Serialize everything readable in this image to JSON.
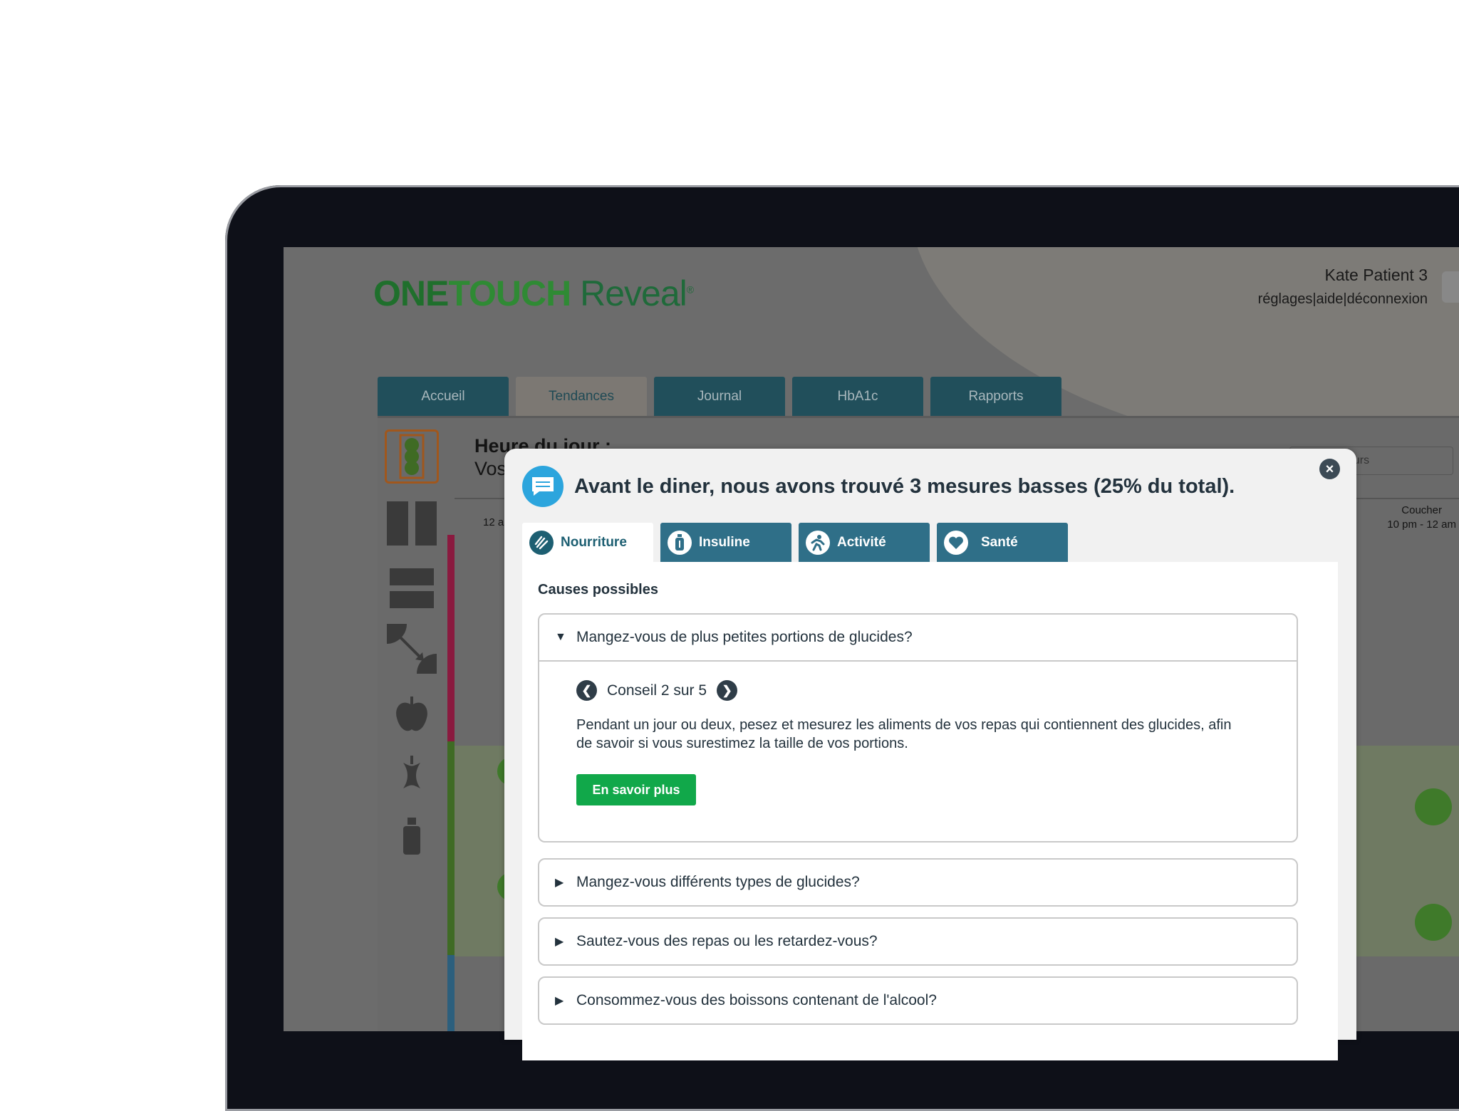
{
  "app": {
    "logo_one": "ONE",
    "logo_touch": "TOUCH",
    "logo_reveal": "Reveal",
    "logo_reg": "®"
  },
  "user": {
    "name": "Kate Patient 3",
    "links": [
      "réglages",
      "aide",
      "déconnexion"
    ],
    "separator": " | "
  },
  "nav": {
    "tabs": [
      "Accueil",
      "Tendances",
      "Journal",
      "HbA1c",
      "Rapports"
    ],
    "active_index": 1
  },
  "background_page": {
    "heading": "Heure du jour :",
    "subheading": "Vos",
    "axis_left_label": "12 a",
    "axis_right_label_line1": "Coucher",
    "axis_right_label_line2": "10 pm - 12 am",
    "select_value": "ours",
    "sidebar_icons": [
      "traffic-light-icon",
      "split-columns-icon",
      "split-rows-icon",
      "corner-arrow-icon",
      "apple-icon",
      "apple-core-icon",
      "insulin-pen-icon"
    ]
  },
  "modal": {
    "title": "Avant le diner, nous avons trouvé 3 mesures basses (25% du total).",
    "tabs": [
      {
        "label": "Nourriture",
        "icon": "food-icon"
      },
      {
        "label": "Insuline",
        "icon": "insulin-icon"
      },
      {
        "label": "Activité",
        "icon": "activity-icon"
      },
      {
        "label": "Santé",
        "icon": "health-heart-icon"
      }
    ],
    "active_tab": 0,
    "section_heading": "Causes possibles",
    "causes": [
      {
        "question": "Mangez-vous de plus petites portions de glucides?",
        "expanded": true,
        "tip_counter": "Conseil 2 sur 5",
        "tip_text": "Pendant un jour ou deux, pesez et mesurez les aliments de vos repas qui contiennent des glucides, afin de savoir si vous surestimez la taille de vos portions.",
        "button_label": "En savoir plus"
      },
      {
        "question": "Mangez-vous différents types de glucides?",
        "expanded": false
      },
      {
        "question": "Sautez-vous des repas ou les retardez-vous?",
        "expanded": false
      },
      {
        "question": "Consommez-vous des boissons contenant de l'alcool?",
        "expanded": false
      }
    ]
  },
  "colors": {
    "accent_green": "#11a84a",
    "tab_teal": "#2f6f88",
    "bubble_blue": "#2ca5dd",
    "logo_green": "#2f8a34"
  }
}
